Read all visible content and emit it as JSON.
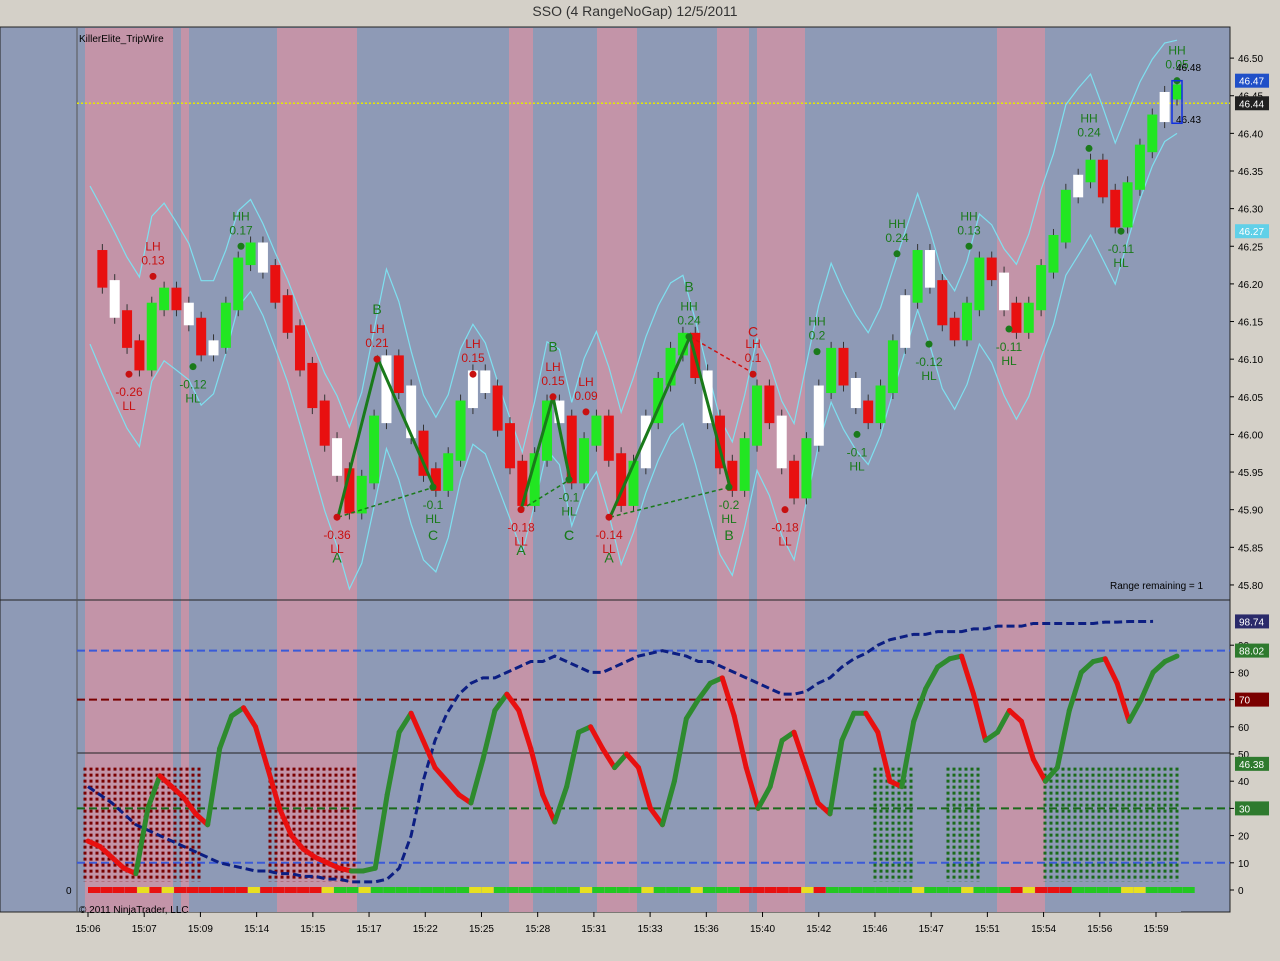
{
  "window": {
    "title": "SSO (4 RangeNoGap)  12/5/2011",
    "indicator_name": "KillerElite_TripWire",
    "range_remaining": "Range remaining = 1",
    "copyright": "© 2011 NinjaTrader, LLC"
  },
  "colors": {
    "panel_blue": "#8e9ab6",
    "panel_pink": "#c394a8",
    "up_bar": "#22e622",
    "white_bar": "#ffffff",
    "down_bar": "#e81010",
    "pattern_green": "#1a7a1a",
    "band_cyan": "#7ee0f0",
    "dotted_yellow": "#e8e800",
    "oscillator_navy": "#0c1e82"
  },
  "chart_data": [
    {
      "type": "candlestick",
      "panel": "price",
      "ylim": [
        45.78,
        46.54
      ],
      "ytick_labels": [
        "46.50",
        "46.45",
        "46.40",
        "46.35",
        "46.30",
        "46.25",
        "46.20",
        "46.15",
        "46.10",
        "46.05",
        "46.00",
        "45.95",
        "45.90",
        "45.85",
        "45.80"
      ],
      "ytick_values": [
        46.5,
        46.45,
        46.4,
        46.35,
        46.3,
        46.25,
        46.2,
        46.15,
        46.1,
        46.05,
        46.0,
        45.95,
        45.9,
        45.85,
        45.8
      ],
      "price_badges": [
        {
          "text": "46.47",
          "value": 46.47,
          "color": "#2050c8"
        },
        {
          "text": "46.44",
          "value": 46.44,
          "color": "#202020"
        },
        {
          "text": "46.27",
          "value": 46.27,
          "color": "#60d0e8"
        }
      ],
      "yellow_line": 46.44,
      "xtick_labels": [
        "15:06",
        "15:07",
        "15:09",
        "15:14",
        "15:15",
        "15:17",
        "15:22",
        "15:25",
        "15:28",
        "15:31",
        "15:33",
        "15:36",
        "15:40",
        "15:42",
        "15:46",
        "15:47",
        "15:51",
        "15:54",
        "15:56",
        "15:59"
      ],
      "close_path": [
        46.24,
        46.2,
        46.16,
        46.12,
        46.09,
        46.17,
        46.19,
        46.17,
        46.15,
        46.11,
        46.12,
        46.17,
        46.23,
        46.25,
        46.22,
        46.18,
        46.14,
        46.09,
        46.04,
        45.99,
        45.95,
        45.9,
        45.94,
        46.02,
        46.1,
        46.06,
        46.0,
        45.95,
        45.93,
        45.97,
        46.04,
        46.08,
        46.06,
        46.01,
        45.96,
        45.91,
        45.97,
        46.04,
        46.02,
        45.94,
        45.99,
        46.02,
        45.97,
        45.91,
        45.96,
        46.02,
        46.07,
        46.11,
        46.13,
        46.08,
        46.02,
        45.96,
        45.93,
        45.99,
        46.06,
        46.02,
        45.96,
        45.92,
        45.99,
        46.06,
        46.11,
        46.07,
        46.04,
        46.02,
        46.06,
        46.12,
        46.18,
        46.24,
        46.2,
        46.15,
        46.13,
        46.17,
        46.23,
        46.21,
        46.17,
        46.14,
        46.17,
        46.22,
        46.26,
        46.32,
        46.34,
        46.36,
        46.32,
        46.28,
        46.33,
        46.38,
        46.42,
        46.45,
        46.46
      ],
      "swing_labels": [
        {
          "top": "LH",
          "bottom": "0.13",
          "value": 46.21
        },
        {
          "top": "-0.26",
          "bottom": "LL",
          "value": 46.08
        },
        {
          "top": "-0.12",
          "bottom": "HL",
          "value": 46.09
        },
        {
          "top": "HH",
          "bottom": "0.17",
          "value": 46.25
        },
        {
          "top": "-0.36",
          "bottom": "LL",
          "value": 45.89
        },
        {
          "top": "LH",
          "bottom": "0.21",
          "value": 46.1
        },
        {
          "top": "-0.1",
          "bottom": "HL",
          "value": 45.93
        },
        {
          "top": "LH",
          "bottom": "0.15",
          "value": 46.08
        },
        {
          "top": "-0.18",
          "bottom": "LL",
          "value": 45.9
        },
        {
          "top": "LH",
          "bottom": "0.15",
          "value": 46.05
        },
        {
          "top": "-0.1",
          "bottom": "HL",
          "value": 45.94
        },
        {
          "top": "LH",
          "bottom": "0.09",
          "value": 46.03
        },
        {
          "top": "-0.14",
          "bottom": "LL",
          "value": 45.89
        },
        {
          "top": "HH",
          "bottom": "0.24",
          "value": 46.13
        },
        {
          "top": "-0.2",
          "bottom": "HL",
          "value": 45.93
        },
        {
          "top": "LH",
          "bottom": "0.1",
          "value": 46.08
        },
        {
          "top": "-0.18",
          "bottom": "LL",
          "value": 45.9
        },
        {
          "top": "HH",
          "bottom": "0.2",
          "value": 46.11
        },
        {
          "top": "-0.1",
          "bottom": "HL",
          "value": 46.0
        },
        {
          "top": "HH",
          "bottom": "0.24",
          "value": 46.24
        },
        {
          "top": "-0.12",
          "bottom": "HL",
          "value": 46.12
        },
        {
          "top": "HH",
          "bottom": "0.13",
          "value": 46.25
        },
        {
          "top": "-0.11",
          "bottom": "HL",
          "value": 46.14
        },
        {
          "top": "HH",
          "bottom": "0.24",
          "value": 46.38
        },
        {
          "top": "-0.11",
          "bottom": "HL",
          "value": 46.27
        },
        {
          "top": "HH",
          "bottom": "0.05",
          "value": 46.47
        }
      ],
      "abc_labels": [
        "A",
        "B",
        "C",
        "A",
        "B",
        "C",
        "A",
        "B",
        "B",
        "C",
        "C"
      ],
      "last_bar_labels": {
        "high": "46.48",
        "low": "46.43"
      }
    },
    {
      "type": "line",
      "panel": "oscillator",
      "ylim": [
        0,
        100
      ],
      "ytick_labels": [
        "90",
        "80",
        "70",
        "60",
        "50",
        "40",
        "30",
        "20",
        "10",
        "0"
      ],
      "ytick_values": [
        90,
        80,
        70,
        60,
        50,
        40,
        30,
        20,
        10,
        0
      ],
      "badges": [
        {
          "text": "98.74",
          "value": 98.74,
          "color": "#2a2a6a"
        },
        {
          "text": "88.02",
          "value": 88.02,
          "color": "#2e7a2e"
        },
        {
          "text": "70",
          "value": 70,
          "color": "#7a0000"
        },
        {
          "text": "46.38",
          "value": 46.38,
          "color": "#2e7a2e"
        },
        {
          "text": "30",
          "value": 30,
          "color": "#2e7a2e"
        }
      ],
      "levels": [
        88,
        70,
        30,
        10
      ],
      "left_label": "0",
      "series": [
        {
          "values": [
            18,
            16,
            12,
            8,
            6,
            30,
            42,
            38,
            34,
            28,
            24,
            52,
            64,
            67,
            60,
            45,
            30,
            20,
            15,
            12,
            10,
            8,
            7,
            7,
            8,
            35,
            58,
            65,
            55,
            45,
            40,
            35,
            32,
            48,
            66,
            72,
            66,
            52,
            35,
            25,
            38,
            58,
            60,
            52,
            45,
            50,
            45,
            30,
            24,
            40,
            63,
            70,
            76,
            78,
            64,
            45,
            30,
            38,
            55,
            58,
            45,
            32,
            28,
            55,
            65,
            65,
            58,
            40,
            38,
            62,
            74,
            82,
            85,
            86,
            72,
            55,
            58,
            66,
            62,
            48,
            40,
            45,
            66,
            80,
            84,
            85,
            76,
            62,
            70,
            80,
            84,
            86
          ]
        },
        {
          "values": [
            38,
            35,
            32,
            28,
            24,
            22,
            20,
            18,
            16,
            14,
            12,
            10,
            9,
            8,
            7,
            7,
            6,
            6,
            5,
            5,
            4,
            4,
            3,
            3,
            3,
            4,
            8,
            20,
            40,
            55,
            65,
            72,
            76,
            78,
            78,
            80,
            82,
            84,
            84,
            86,
            84,
            82,
            80,
            80,
            82,
            84,
            86,
            87,
            88,
            87,
            86,
            84,
            84,
            82,
            80,
            78,
            76,
            74,
            72,
            72,
            73,
            76,
            78,
            82,
            85,
            87,
            90,
            92,
            93,
            94,
            94,
            95,
            95,
            95,
            96,
            96,
            97,
            97,
            97,
            98,
            98,
            98,
            98,
            98,
            98,
            98.5,
            98.5,
            98.7,
            98.7,
            98.74
          ]
        }
      ]
    }
  ]
}
